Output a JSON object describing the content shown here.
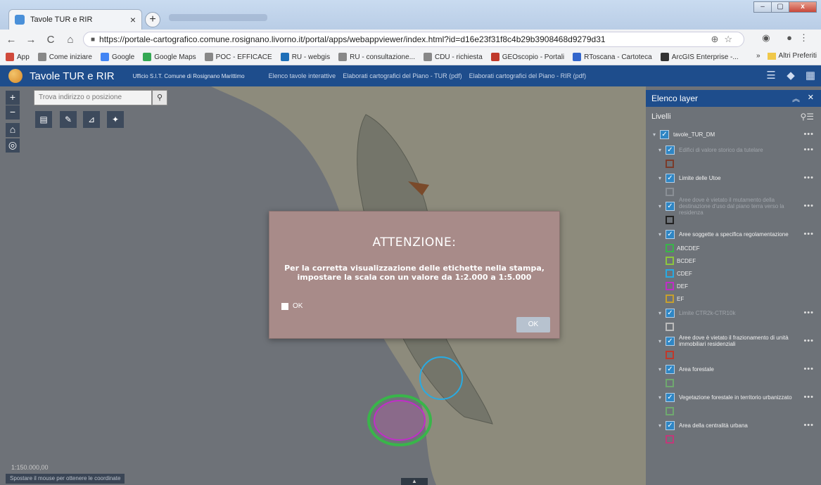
{
  "browser": {
    "tab_title": "Tavole TUR e RIR",
    "tab_close": "×",
    "new_tab": "+",
    "url": "https://portale-cartografico.comune.rosignano.livorno.it/portal/apps/webappviewer/index.html?id=d16e23f31f8c4b29b3908468d9279d31",
    "window_buttons": [
      "–",
      "▢",
      "x"
    ]
  },
  "bookmarks": {
    "items": [
      {
        "label": "App",
        "color": "#d04a3c"
      },
      {
        "label": "Come iniziare",
        "color": "#888888"
      },
      {
        "label": "Google",
        "color": "#4285f4"
      },
      {
        "label": "Google Maps",
        "color": "#34a853"
      },
      {
        "label": "POC - EFFICACE",
        "color": "#888888"
      },
      {
        "label": "RU - webgis",
        "color": "#1e6fb8"
      },
      {
        "label": "RU - consultazione...",
        "color": "#888888"
      },
      {
        "label": "CDU - richiesta",
        "color": "#888888"
      },
      {
        "label": "GEOscopio - Portali",
        "color": "#c0392b"
      },
      {
        "label": "RToscana - Cartoteca",
        "color": "#3366cc"
      },
      {
        "label": "ArcGIS Enterprise -...",
        "color": "#333333"
      }
    ],
    "more": "»",
    "other": "Altri Preferiti"
  },
  "app": {
    "title": "Tavole TUR e RIR",
    "subtitle": "Ufficio S.I.T. Comune di Rosignano Marittimo",
    "links": [
      "Elenco tavole interattive",
      "Elaborati cartografici del Piano - TUR (pdf)",
      "Elaborati cartografici del Piano - RIR (pdf)"
    ]
  },
  "map": {
    "search_placeholder": "Trova indirizzo o posizione",
    "scale": "1:150.000,00",
    "coords_hint": "Spostare il mouse per ottenere le coordinate"
  },
  "layer_panel": {
    "title": "Elenco layer",
    "section": "Livelli",
    "layers": [
      {
        "name": "tavole_TUR_DM",
        "dim": false,
        "swatches": []
      },
      {
        "name": "Edifici di valore storico da tutelare",
        "dim": true,
        "swatches": [
          {
            "label": "",
            "color": "#7a3b2a"
          }
        ]
      },
      {
        "name": "Limite delle Utoe",
        "dim": false,
        "swatches": [
          {
            "label": "",
            "color": "#8a8f95"
          }
        ]
      },
      {
        "name": "Aree dove è vietato il mutamento della destinazione d'uso dal piano terra verso la residenza",
        "dim": true,
        "swatches": [
          {
            "label": "",
            "color": "#222222"
          }
        ]
      },
      {
        "name": "Aree soggette a specifica regolamentazione",
        "dim": false,
        "swatches": [
          {
            "label": "ABCDEF",
            "color": "#39b54a"
          },
          {
            "label": "BCDEF",
            "color": "#8dc63f"
          },
          {
            "label": "CDEF",
            "color": "#29abe2"
          },
          {
            "label": "DEF",
            "color": "#c02ec7"
          },
          {
            "label": "EF",
            "color": "#c7a02e"
          }
        ]
      },
      {
        "name": "Limite CTR2k-CTR10k",
        "dim": true,
        "swatches": [
          {
            "label": "",
            "color": "#bbbbbb"
          }
        ]
      },
      {
        "name": "Aree dove è vietato il frazionamento di unità immobiliari residenziali",
        "dim": false,
        "swatches": [
          {
            "label": "",
            "color": "#c0392b"
          }
        ]
      },
      {
        "name": "Area forestale",
        "dim": false,
        "swatches": [
          {
            "label": "",
            "color": "#6fa86f"
          }
        ]
      },
      {
        "name": "Vegetazione forestale in territorio urbanizzato",
        "dim": false,
        "swatches": [
          {
            "label": "",
            "color": "#6fa86f"
          }
        ]
      },
      {
        "name": "Area della centralità urbana",
        "dim": false,
        "swatches": [
          {
            "label": "",
            "color": "#c0397a"
          }
        ]
      }
    ]
  },
  "modal": {
    "title": "ATTENZIONE:",
    "message_line1": "Per la corretta visualizzazione delle etichette nella stampa,",
    "message_line2": "impostare la scala con un valore da 1:2.000 a 1:5.000",
    "checkbox_label": "OK",
    "ok_button": "OK"
  }
}
